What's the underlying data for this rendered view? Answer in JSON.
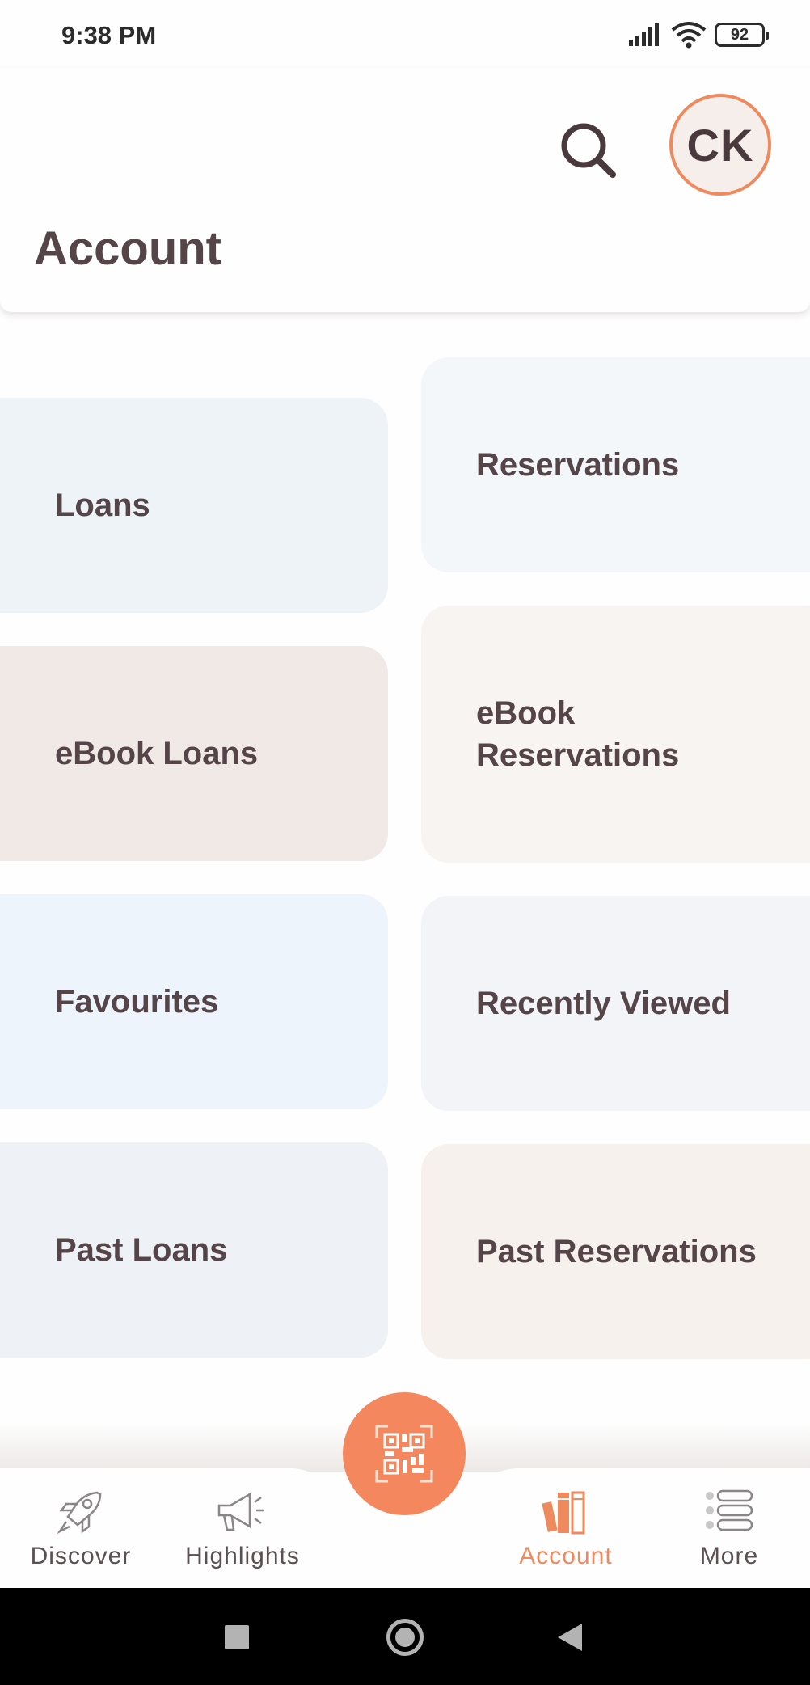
{
  "status_bar": {
    "time": "9:38 PM",
    "battery": "92"
  },
  "header": {
    "title": "Account",
    "avatar_initials": "CK"
  },
  "cards": {
    "loans": "Loans",
    "reservations": "Reservations",
    "ebook_loans": "eBook Loans",
    "ebook_reservations": "eBook Reservations",
    "favourites": "Favourites",
    "recently_viewed": "Recently Viewed",
    "past_loans": "Past Loans",
    "past_reservations": "Past Reservations"
  },
  "bottom_nav": {
    "items": [
      {
        "label": "Discover",
        "icon": "rocket-icon"
      },
      {
        "label": "Highlights",
        "icon": "megaphone-icon"
      },
      {
        "label": "Account",
        "icon": "books-icon",
        "active": true
      },
      {
        "label": "More",
        "icon": "list-icon"
      }
    ],
    "center_button_icon": "qr-code-icon"
  },
  "colors": {
    "accent": "#F4875D",
    "text": "#554548"
  }
}
